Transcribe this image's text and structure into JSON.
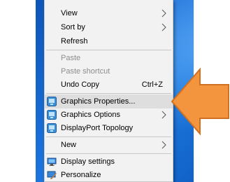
{
  "context_menu": {
    "items": [
      {
        "label": "View",
        "submenu": true,
        "disabled": false
      },
      {
        "label": "Sort by",
        "submenu": true,
        "disabled": false
      },
      {
        "label": "Refresh",
        "submenu": false,
        "disabled": false
      },
      {
        "label": "Paste",
        "submenu": false,
        "disabled": true
      },
      {
        "label": "Paste shortcut",
        "submenu": false,
        "disabled": true
      },
      {
        "label": "Undo Copy",
        "shortcut": "Ctrl+Z",
        "submenu": false,
        "disabled": false
      },
      {
        "label": "Graphics Properties...",
        "icon": "intel-graphics-icon",
        "highlighted": true
      },
      {
        "label": "Graphics Options",
        "icon": "intel-graphics-icon",
        "submenu": true
      },
      {
        "label": "DisplayPort Topology",
        "icon": "intel-graphics-icon"
      },
      {
        "label": "New",
        "submenu": true
      },
      {
        "label": "Display settings",
        "icon": "display-settings-icon"
      },
      {
        "label": "Personalize",
        "icon": "personalize-icon"
      }
    ]
  },
  "colors": {
    "arrow_fill": "#f3943f",
    "arrow_stroke": "#d07020",
    "menu_bg": "#f2f2f2",
    "highlight_bg": "#dedede",
    "desktop_blue": "#1a6fd8"
  }
}
